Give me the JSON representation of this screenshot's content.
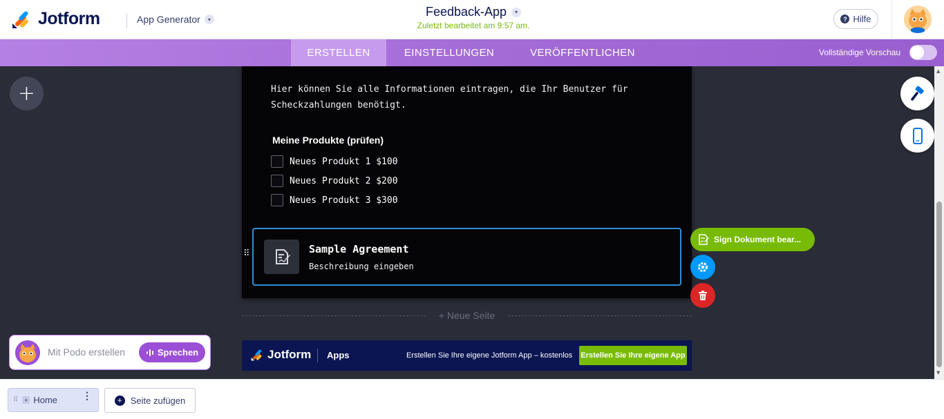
{
  "header": {
    "brand": "Jotform",
    "app_generator_label": "App Generator",
    "app_title": "Feedback-App",
    "last_edited": "Zuletzt bearbeitet am 9:57 am.",
    "help_label": "Hilfe"
  },
  "nav": {
    "tabs": [
      {
        "label": "ERSTELLEN",
        "active": true
      },
      {
        "label": "EINSTELLUNGEN",
        "active": false
      },
      {
        "label": "VERÖFFENTLICHEN",
        "active": false
      }
    ],
    "full_preview_label": "Vollständige Vorschau",
    "full_preview_enabled": false
  },
  "form": {
    "intro_text": "Hier können Sie alle Informationen eintragen, die Ihr Benutzer für Scheckzahlungen benötigt.",
    "products_label": "Meine Produkte (prüfen)",
    "products": [
      {
        "label": "Neues Produkt 1 $100",
        "checked": false
      },
      {
        "label": "Neues Produkt 2 $200",
        "checked": false
      },
      {
        "label": "Neues Produkt 3 $300",
        "checked": false
      }
    ],
    "agreement": {
      "title": "Sample Agreement",
      "description": "Beschreibung eingeben"
    }
  },
  "element_actions": {
    "sign_label": "Sign Dokument bear..."
  },
  "new_page_label": "+ Neue Seite",
  "footer_banner": {
    "brand": "Jotform",
    "apps_label": "Apps",
    "promo_text": "Erstellen Sie Ihre eigene Jotform App – kostenlos",
    "cta_label": "Erstellen Sie Ihre eigene App"
  },
  "podo": {
    "placeholder": "Mit Podo erstellen",
    "speak_label": "Sprechen"
  },
  "bottom": {
    "pages": [
      {
        "label": "Home"
      }
    ],
    "add_page_label": "Seite zufügen"
  },
  "colors": {
    "brand_navy": "#0a1551",
    "accent_purple": "#9b4fd6",
    "success_green": "#78bb07",
    "selection_blue": "#2f8fd8",
    "danger_red": "#dc2626",
    "settings_blue": "#0099ff"
  },
  "icons": [
    "jotform-logo-icon",
    "chevron-down-icon",
    "help-icon",
    "user-avatar",
    "plus-icon",
    "checkbox-icon",
    "document-edit-icon",
    "drag-handle-icon",
    "sign-icon",
    "gear-icon",
    "trash-icon",
    "paint-roller-icon",
    "mobile-phone-icon",
    "microphone-icon",
    "kebab-menu-icon"
  ]
}
